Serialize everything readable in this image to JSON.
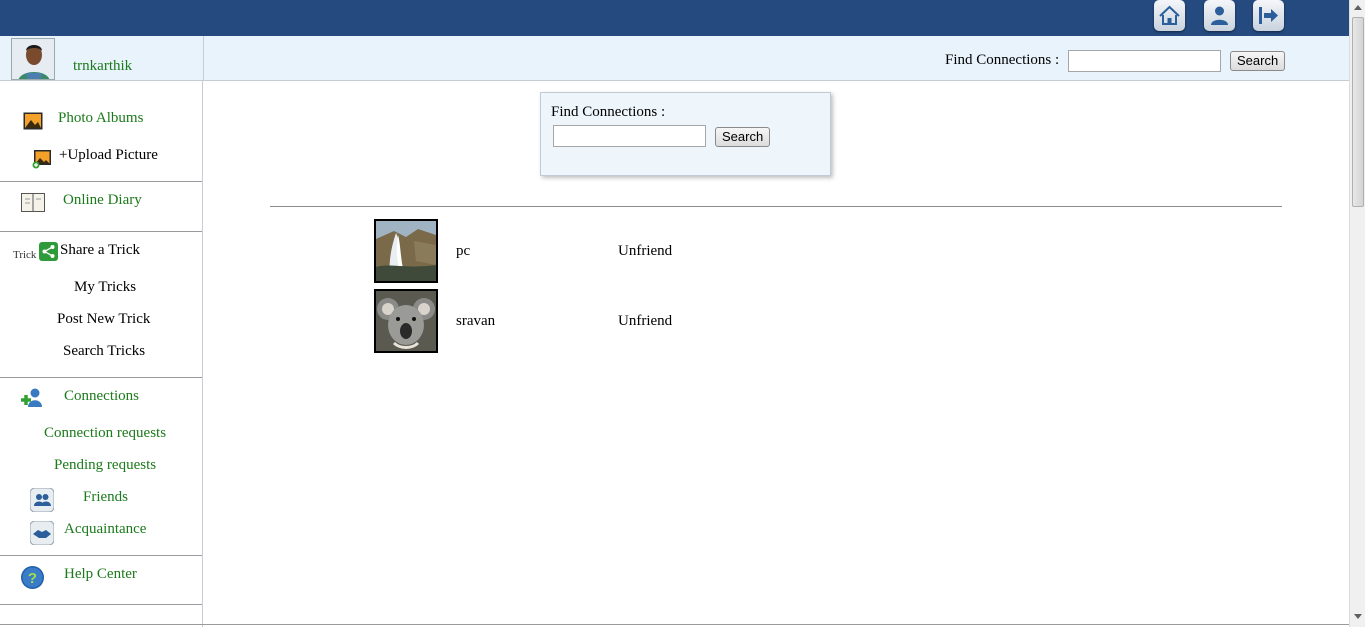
{
  "header": {
    "icons": [
      "home-icon",
      "profile-icon",
      "logout-icon"
    ],
    "colors": {
      "topbar": "#244a7f",
      "subbar": "#e9f3fb",
      "link_green": "#1b7a1b"
    }
  },
  "user": {
    "name": "trnkarthik"
  },
  "top_search": {
    "label": "Find Connections :",
    "value": "",
    "button": "Search"
  },
  "sidebar": {
    "photo_albums": "Photo Albums",
    "upload_picture": "+Upload Picture",
    "online_diary": "Online Diary",
    "trick_small": "Trick",
    "share_trick": "Share a Trick",
    "my_tricks": "My Tricks",
    "post_new_trick": "Post New Trick",
    "search_tricks": "Search Tricks",
    "connections": "Connections",
    "connection_requests": "Connection requests",
    "pending_requests": "Pending requests",
    "friends": "Friends",
    "acquaintance": "Acquaintance",
    "help_center": "Help Center"
  },
  "find_box": {
    "label": "Find Connections :",
    "value": "",
    "button": "Search"
  },
  "connections": [
    {
      "name": "pc",
      "action": "Unfriend",
      "thumb": "waterfall"
    },
    {
      "name": "sravan",
      "action": "Unfriend",
      "thumb": "koala"
    }
  ]
}
